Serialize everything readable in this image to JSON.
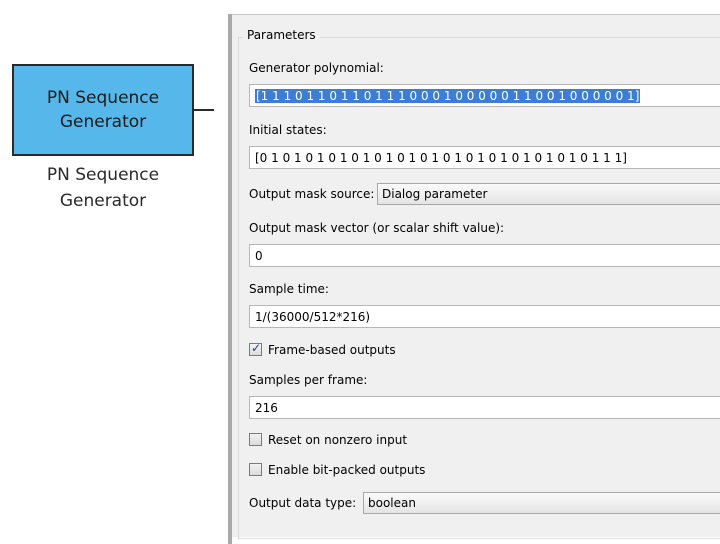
{
  "block": {
    "title_line1": "PN Sequence",
    "title_line2": "Generator",
    "caption_line1": "PN Sequence",
    "caption_line2": "Generator",
    "fill_color": "#56b8ea"
  },
  "dialog": {
    "group_title": "Parameters",
    "generator_polynomial": {
      "label": "Generator polynomial:",
      "value": "[1 1 1 0 1 1 0 1 1 0 1 1 1 0 0 0 1 0 0 0 0 0 1 1 0 0 1 0 0 0 0 0 1]"
    },
    "initial_states": {
      "label": "Initial states:",
      "value": "[0 1 0 1 0 1 0 1 0 1 0 1 0 1 0 1 0 1 0 1 0 1 0 1 0 1 0 1 0 1 1 1]"
    },
    "output_mask_source": {
      "label": "Output mask source:",
      "value": "Dialog parameter"
    },
    "output_mask_vector": {
      "label": "Output mask vector (or scalar shift value):",
      "value": "0"
    },
    "sample_time": {
      "label": "Sample time:",
      "value": "1/(36000/512*216)"
    },
    "frame_based": {
      "label": "Frame-based outputs",
      "checked": true
    },
    "samples_per_frame": {
      "label": "Samples per frame:",
      "value": "216"
    },
    "reset_nonzero": {
      "label": "Reset on nonzero input",
      "checked": false
    },
    "bit_packed": {
      "label": "Enable bit-packed outputs",
      "checked": false
    },
    "output_data_type": {
      "label": "Output data type:",
      "value": "boolean"
    },
    "selection_color": "#3b7ed4"
  }
}
